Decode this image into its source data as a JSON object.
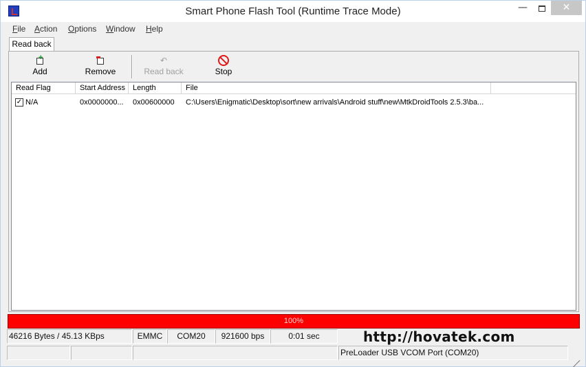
{
  "window": {
    "title": "Smart Phone Flash Tool (Runtime Trace Mode)",
    "minimize_glyph": "—",
    "close_glyph": "✕"
  },
  "menu": [
    {
      "accel": "F",
      "rest": "ile"
    },
    {
      "accel": "A",
      "rest": "ction"
    },
    {
      "accel": "O",
      "rest": "ptions"
    },
    {
      "accel": "W",
      "rest": "indow"
    },
    {
      "accel": "H",
      "rest": "elp"
    }
  ],
  "tabs": [
    {
      "label": "Read back",
      "active": true
    }
  ],
  "toolbar": {
    "add": {
      "label": "Add",
      "icon": "add-icon",
      "enabled": true
    },
    "remove": {
      "label": "Remove",
      "icon": "remove-icon",
      "enabled": true
    },
    "readback": {
      "label": "Read back",
      "icon": "undo-arrow-icon",
      "enabled": false
    },
    "stop": {
      "label": "Stop",
      "icon": "stop-icon",
      "enabled": true
    }
  },
  "table": {
    "columns": [
      "Read Flag",
      "Start Address",
      "Length",
      "File"
    ],
    "rows": [
      {
        "checked": true,
        "check_glyph": "✓",
        "read_flag": "N/A",
        "start_address": "0x0000000...",
        "length": "0x00600000",
        "file": "C:\\Users\\Enigmatic\\Desktop\\sort\\new arrivals\\Android stuff\\new\\MtkDroidTools 2.5.3\\ba..."
      }
    ]
  },
  "progress": {
    "value": 1.0,
    "text": "100%",
    "color": "#ff0000"
  },
  "status": {
    "transfer": "46216 Bytes / 45.13 KBps",
    "storage": "EMMC",
    "port": "COM20",
    "baud": "921600 bps",
    "elapsed": "0:01 sec",
    "url": "http://hovatek.com",
    "device": "PreLoader USB VCOM Port (COM20)"
  }
}
